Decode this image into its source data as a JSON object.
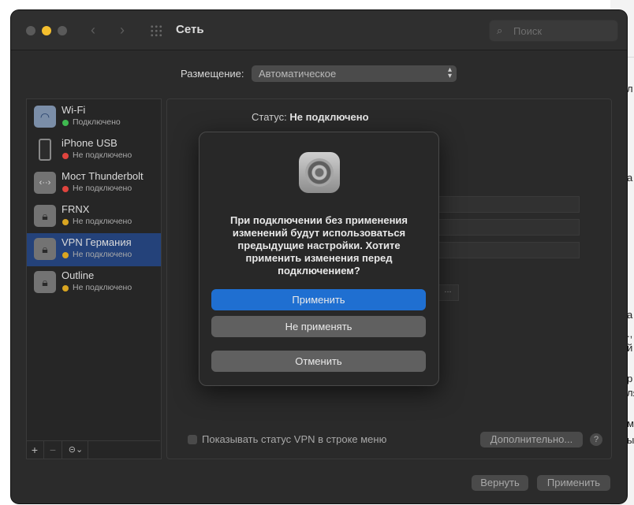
{
  "background": {
    "fragments": [
      "л",
      "а",
      "., в",
      "й",
      "р",
      "ля",
      "мы",
      "ы"
    ]
  },
  "window": {
    "title": "Сеть",
    "search_placeholder": "Поиск",
    "location_label": "Размещение:",
    "location_value": "Автоматическое"
  },
  "services": [
    {
      "name": "Wi-Fi",
      "status": "Подключено",
      "status_color": "#3fb950",
      "icon": "wifi-icon"
    },
    {
      "name": "iPhone USB",
      "status": "Не подключено",
      "status_color": "#e0443e",
      "icon": "iphone-icon"
    },
    {
      "name": "Мост Thunderbolt",
      "status": "Не подключено",
      "status_color": "#e0443e",
      "icon": "thunderbolt-bridge-icon"
    },
    {
      "name": "FRNX",
      "status": "Не подключено",
      "status_color": "#d9a521",
      "icon": "lock-icon"
    },
    {
      "name": "VPN Германия",
      "status": "Не подключено",
      "status_color": "#d9a521",
      "icon": "lock-icon"
    },
    {
      "name": "Outline",
      "status": "Не подключено",
      "status_color": "#d9a521",
      "icon": "lock-icon"
    }
  ],
  "panel": {
    "status_label": "Статус:",
    "status_value": "Не подключено",
    "show_vpn_label": "Показывать статус VPN в строке меню",
    "advanced_button": "Дополнительно...",
    "help": "?",
    "revert_button": "Вернуть",
    "apply_button": "Применить",
    "partial_button": "..."
  },
  "sidebar_controls": {
    "add": "+",
    "remove": "−",
    "actions": "⊝⌄"
  },
  "dialog": {
    "message": "При подключении без применения изменений будут использоваться предыдущие настройки. Хотите применить изменения перед подключением?",
    "apply": "Применить",
    "dont_apply": "Не применять",
    "cancel": "Отменить"
  }
}
